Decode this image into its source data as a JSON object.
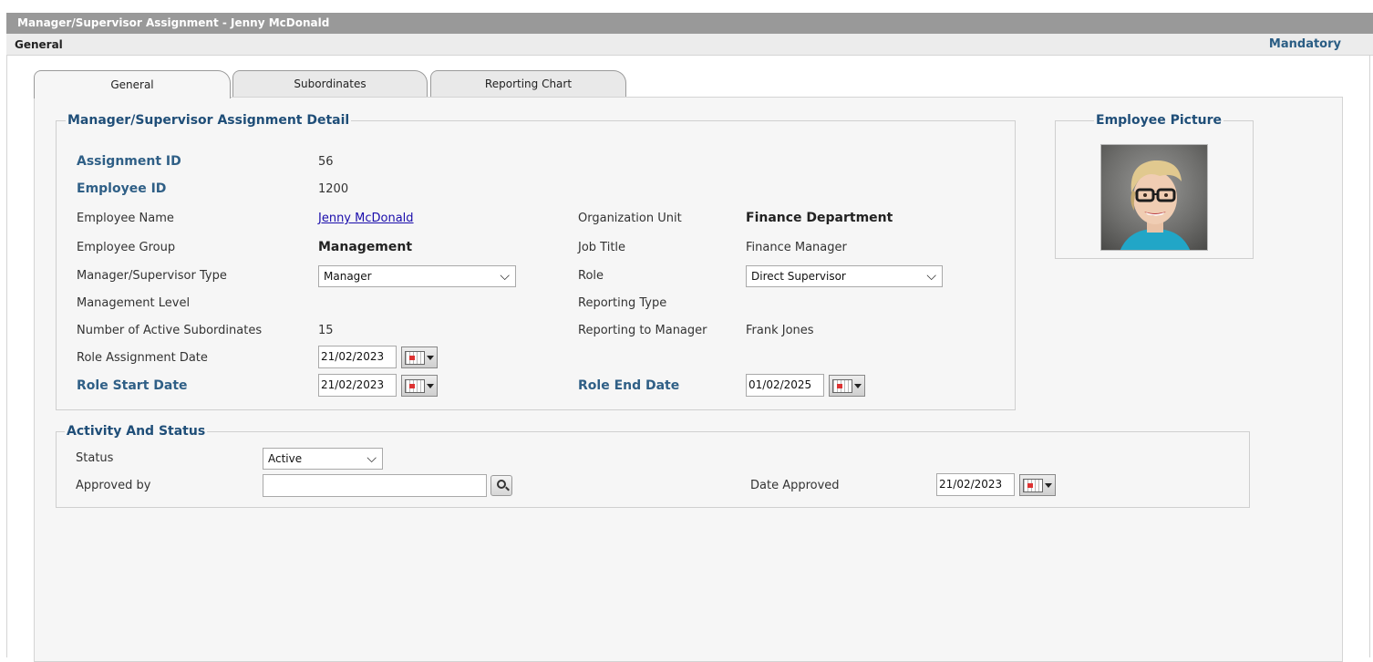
{
  "window": {
    "title": "Manager/Supervisor Assignment - Jenny McDonald"
  },
  "section": {
    "title": "General",
    "mandatory": "Mandatory"
  },
  "tabs": [
    {
      "label": "General",
      "active": true
    },
    {
      "label": "Subordinates",
      "active": false
    },
    {
      "label": "Reporting Chart",
      "active": false
    }
  ],
  "detail": {
    "legend": "Manager/Supervisor Assignment Detail",
    "assignment_id_label": "Assignment ID",
    "assignment_id": "56",
    "employee_id_label": "Employee ID",
    "employee_id": "1200",
    "employee_name_label": "Employee Name",
    "employee_name": "Jenny McDonald",
    "employee_group_label": "Employee Group",
    "employee_group": "Management",
    "manager_type_label": "Manager/Supervisor Type",
    "manager_type": "Manager",
    "management_level_label": "Management Level",
    "active_subordinates_label": "Number of Active Subordinates",
    "active_subordinates": "15",
    "role_assignment_date_label": "Role Assignment Date",
    "role_assignment_date": "21/02/2023",
    "role_start_date_label": "Role Start Date",
    "role_start_date": "21/02/2023",
    "org_unit_label": "Organization Unit",
    "org_unit": "Finance Department",
    "job_title_label": "Job Title",
    "job_title": "Finance Manager",
    "role_label": "Role",
    "role": "Direct Supervisor",
    "reporting_type_label": "Reporting Type",
    "reporting_manager_label": "Reporting to Manager",
    "reporting_manager": "Frank Jones",
    "role_end_date_label": "Role End Date",
    "role_end_date": "01/02/2025"
  },
  "picture": {
    "legend": "Employee Picture"
  },
  "activity": {
    "legend": "Activity And Status",
    "status_label": "Status",
    "status": "Active",
    "approved_by_label": "Approved by",
    "approved_by": "",
    "date_approved_label": "Date Approved",
    "date_approved": "21/02/2023"
  },
  "icons": {
    "calendar": "calendar-icon",
    "search": "search-icon",
    "dropdown": "chevron-down-icon"
  },
  "colors": {
    "key_label": "#2f5f86",
    "title_bar": "#999999",
    "legend": "#1f4e78"
  }
}
